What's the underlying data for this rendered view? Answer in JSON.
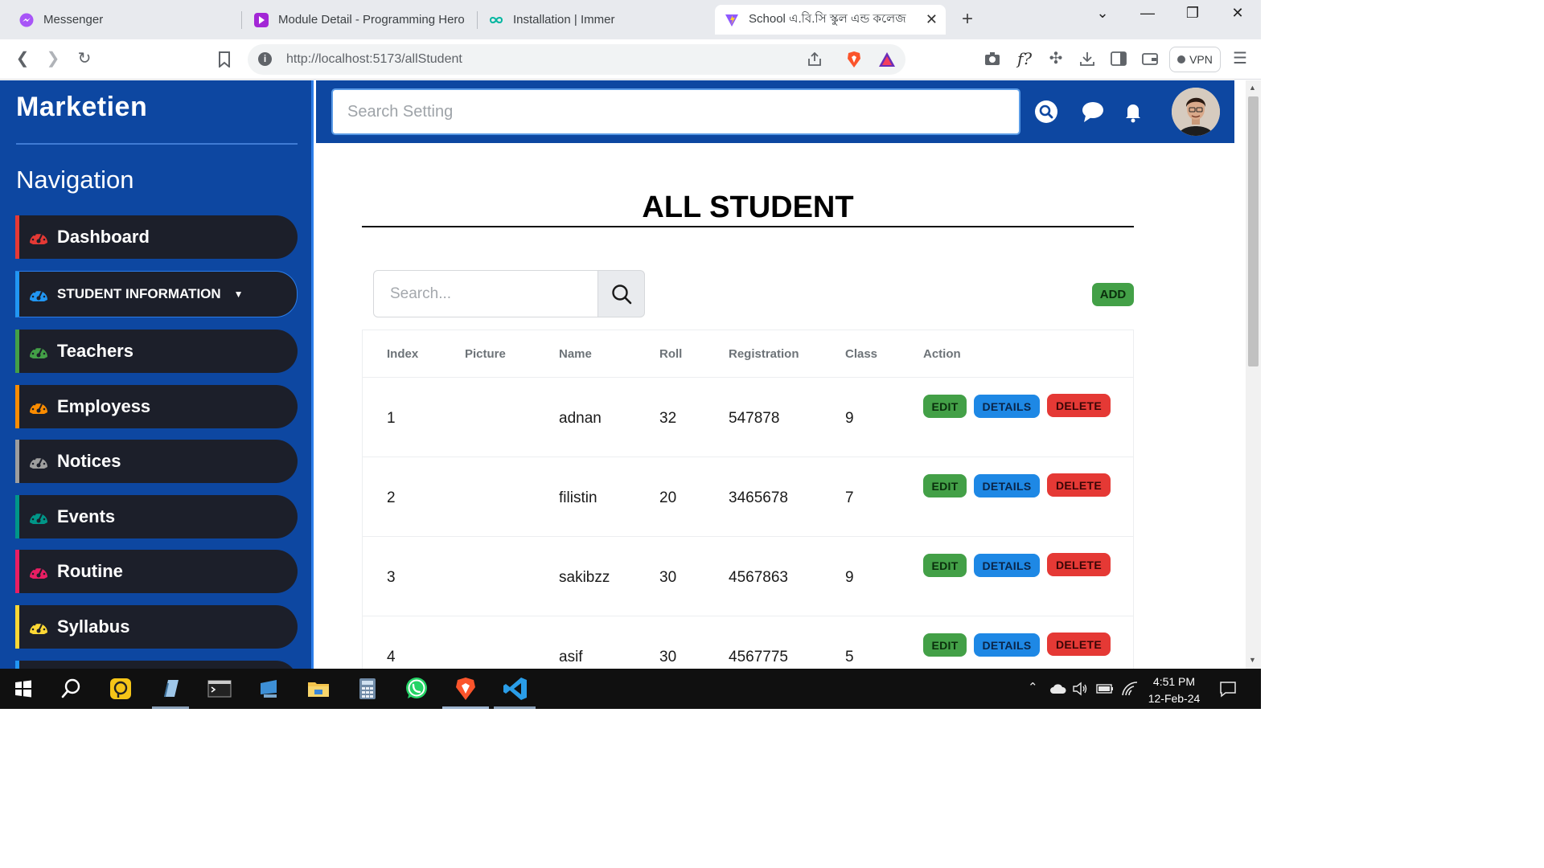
{
  "browser": {
    "tabs": [
      {
        "title": "Messenger",
        "icon": "messenger-icon",
        "color": "#a855f7"
      },
      {
        "title": "Module Detail - Programming Hero",
        "icon": "programming-hero-icon",
        "color": "#a327d6"
      },
      {
        "title": "Installation | Immer",
        "icon": "immer-icon",
        "color": "#00b6a0"
      },
      {
        "title": "School এ.বি.সি স্কুল এন্ড কলেজ",
        "icon": "vite-icon",
        "color": "#8f59ff",
        "active": true
      }
    ],
    "url": "http://localhost:5173/allStudent",
    "vpn_label": "VPN",
    "formula_label": "f?"
  },
  "sidebar": {
    "logo": "Marketien",
    "nav_title": "Navigation",
    "items": [
      {
        "label": "Dashboard",
        "accent": "#e53935"
      },
      {
        "label": "STUDENT INFORMATION",
        "accent": "#2196f3",
        "dropdown": true
      },
      {
        "label": "Teachers",
        "accent": "#43a047"
      },
      {
        "label": "Employess",
        "accent": "#fb8c00"
      },
      {
        "label": "Notices",
        "accent": "#9e9e9e"
      },
      {
        "label": "Events",
        "accent": "#009688"
      },
      {
        "label": "Routine",
        "accent": "#e91e63"
      },
      {
        "label": "Syllabus",
        "accent": "#fdd835"
      }
    ]
  },
  "topbar": {
    "search_placeholder": "Search Setting"
  },
  "main": {
    "title": "ALL STUDENT",
    "search_placeholder": "Search...",
    "add_label": "ADD",
    "columns": [
      "Index",
      "Picture",
      "Name",
      "Roll",
      "Registration",
      "Class",
      "Action"
    ],
    "rows": [
      {
        "index": "1",
        "picture": "",
        "name": "adnan",
        "roll": "32",
        "registration": "547878",
        "class": "9"
      },
      {
        "index": "2",
        "picture": "",
        "name": "filistin",
        "roll": "20",
        "registration": "3465678",
        "class": "7"
      },
      {
        "index": "3",
        "picture": "",
        "name": "sakibzz",
        "roll": "30",
        "registration": "4567863",
        "class": "9"
      },
      {
        "index": "4",
        "picture": "",
        "name": "asif",
        "roll": "30",
        "registration": "4567775",
        "class": "5"
      }
    ],
    "actions": {
      "edit": "EDIT",
      "details": "DETAILS",
      "delete": "DELETE"
    }
  },
  "taskbar": {
    "time": "4:51 PM",
    "date": "12-Feb-24"
  }
}
